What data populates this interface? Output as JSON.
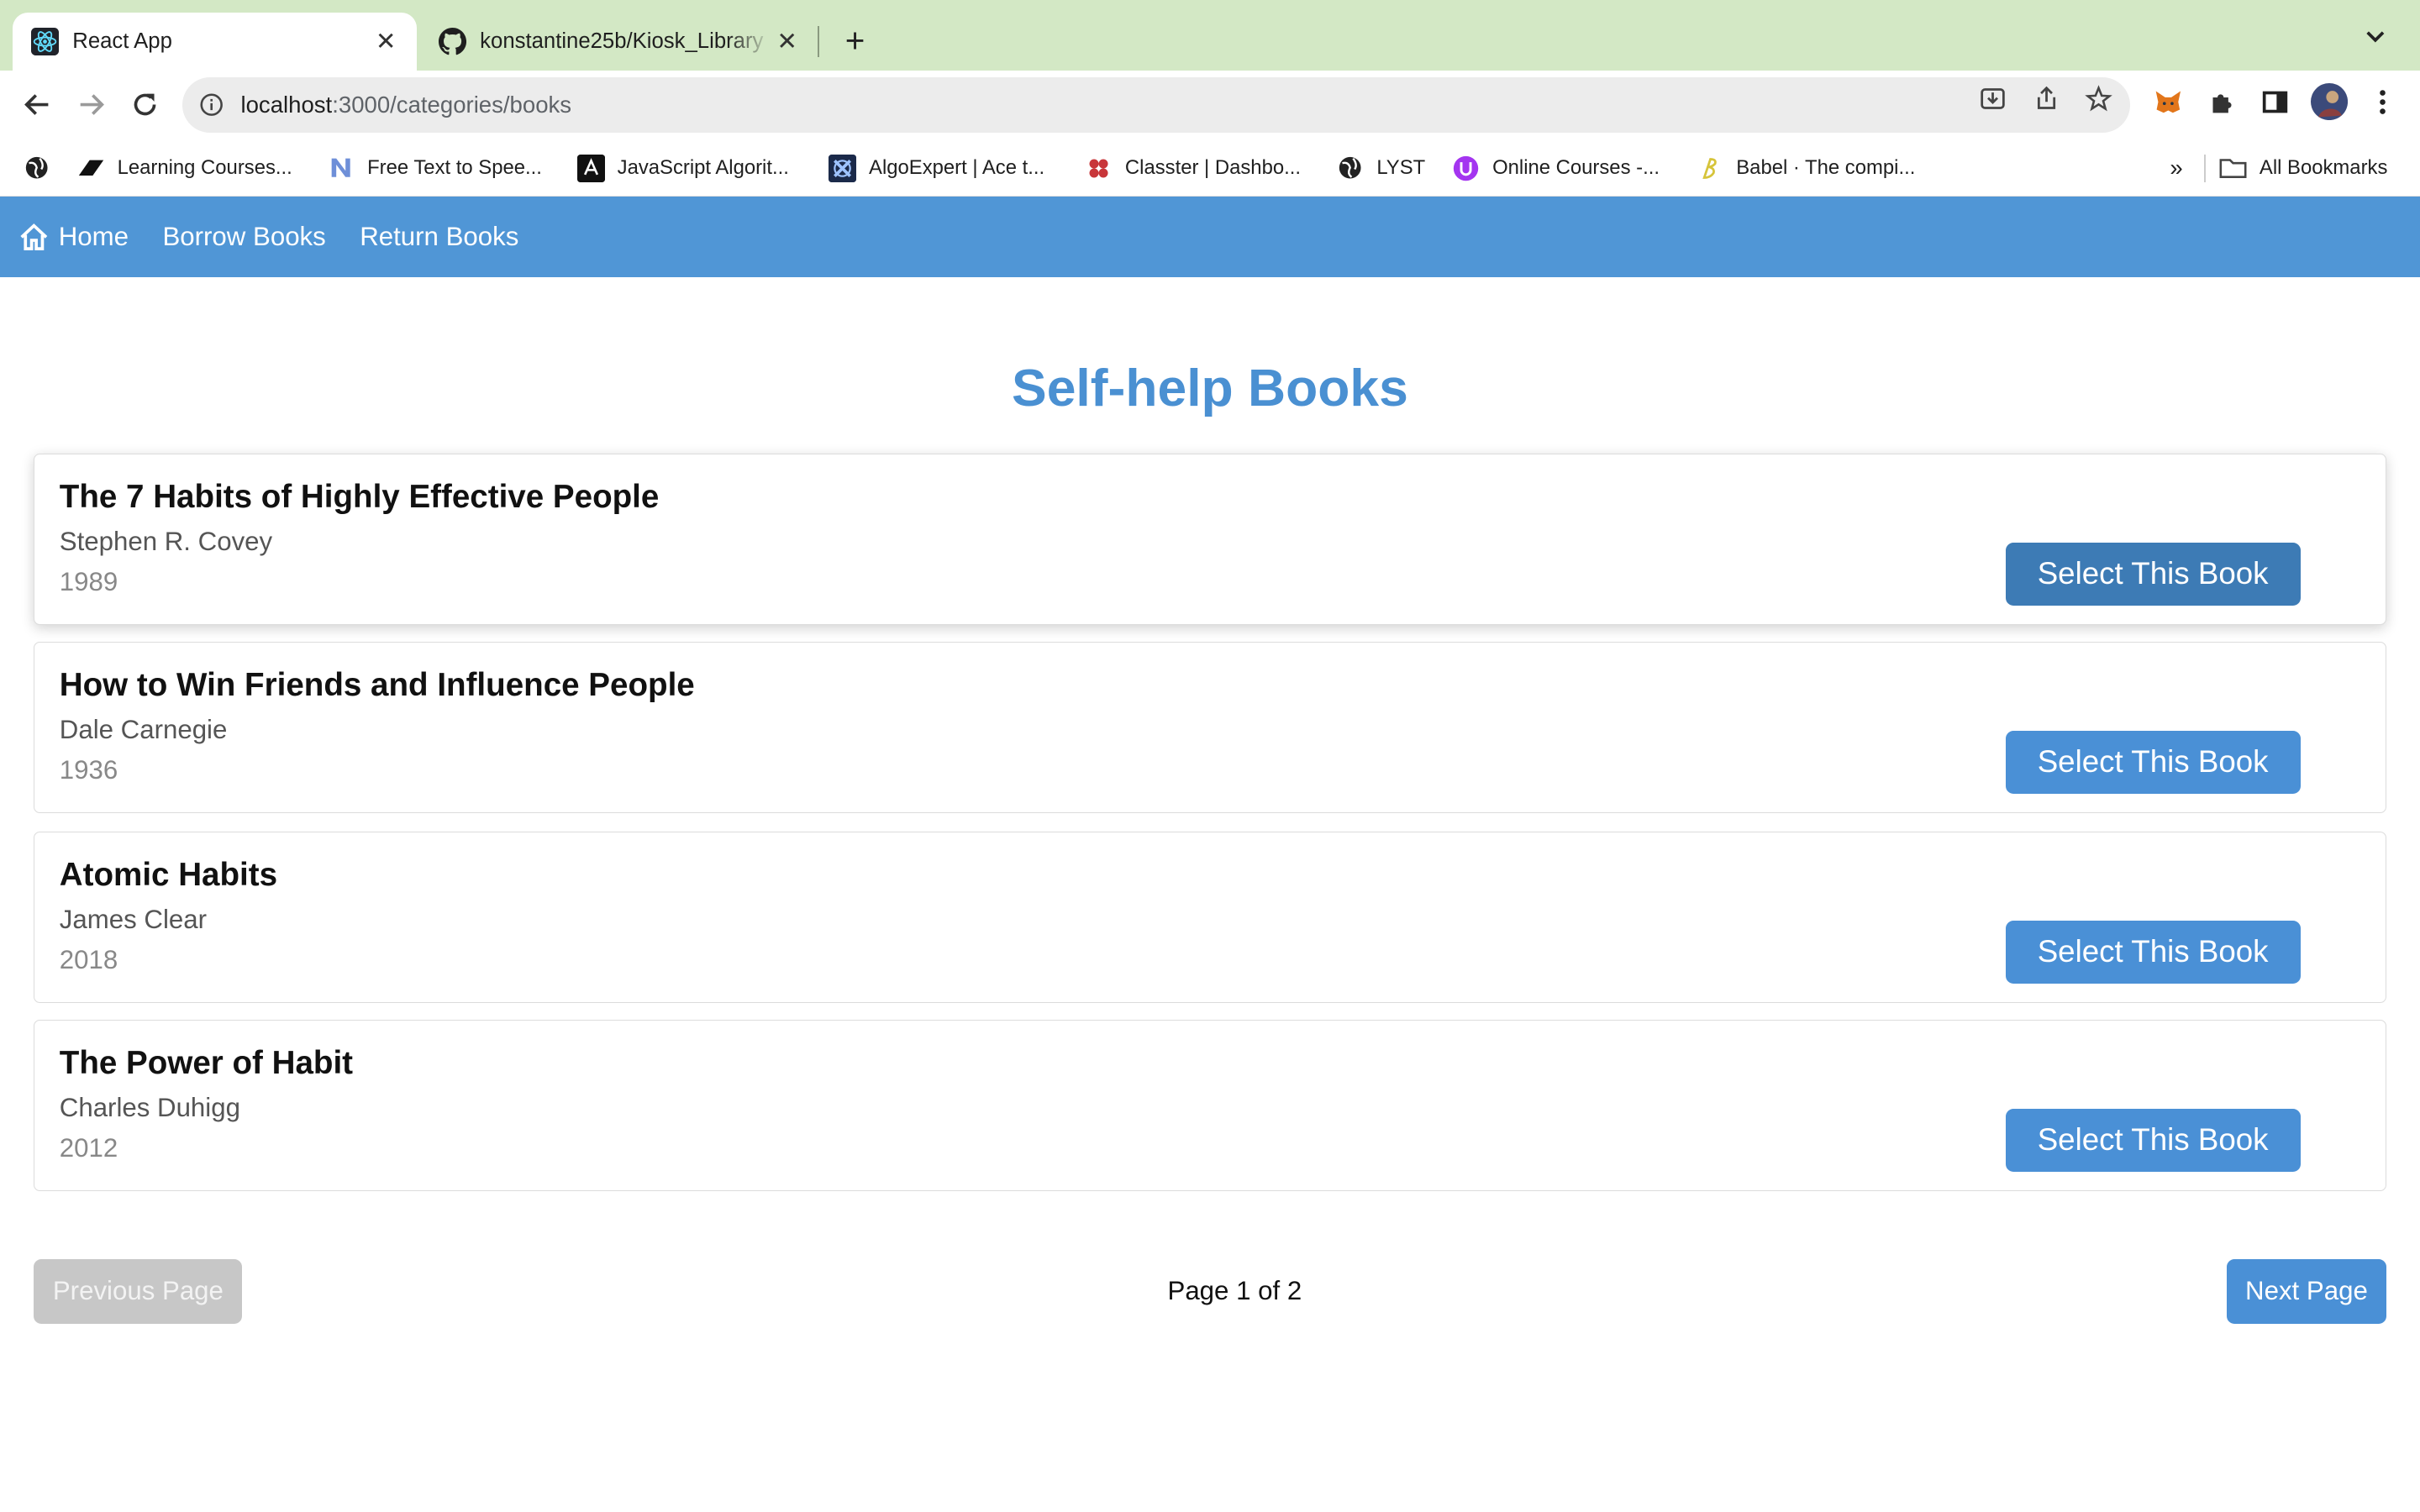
{
  "browser": {
    "tabs": [
      {
        "title": "React App",
        "icon": "react-icon",
        "active": true
      },
      {
        "title": "konstantine25b/Kiosk_Library",
        "icon": "github-icon",
        "active": false
      }
    ],
    "url_host": "localhost",
    "url_path": ":3000/categories/books",
    "bookmarks": [
      {
        "label": "Learning Courses...",
        "icon": "learning-icon"
      },
      {
        "label": "Free Text to Spee...",
        "icon": "n-icon"
      },
      {
        "label": "JavaScript Algorit...",
        "icon": "jsalgo-icon"
      },
      {
        "label": "AlgoExpert | Ace t...",
        "icon": "algoexpert-icon"
      },
      {
        "label": "Classter | Dashbo...",
        "icon": "classter-icon"
      },
      {
        "label": "LYST",
        "icon": "globe-icon"
      },
      {
        "label": "Online Courses -...",
        "icon": "udemy-icon"
      },
      {
        "label": "Babel · The compi...",
        "icon": "babel-icon"
      }
    ],
    "bookmarks_overflow": "»",
    "all_bookmarks": "All Bookmarks"
  },
  "nav": {
    "home": "Home",
    "borrow": "Borrow Books",
    "return": "Return Books",
    "color": "#5096d6"
  },
  "page": {
    "title": "Self-help Books",
    "title_color": "#4a90d2"
  },
  "books": [
    {
      "title": "The 7 Habits of Highly Effective People",
      "author": "Stephen R. Covey",
      "year": "1989",
      "button": "Select This Book"
    },
    {
      "title": "How to Win Friends and Influence People",
      "author": "Dale Carnegie",
      "year": "1936",
      "button": "Select This Book"
    },
    {
      "title": "Atomic Habits",
      "author": "James Clear",
      "year": "2018",
      "button": "Select This Book"
    },
    {
      "title": "The Power of Habit",
      "author": "Charles Duhigg",
      "year": "2012",
      "button": "Select This Book"
    }
  ],
  "pagination": {
    "prev": "Previous Page",
    "next": "Next Page",
    "info": "Page 1 of 2"
  }
}
